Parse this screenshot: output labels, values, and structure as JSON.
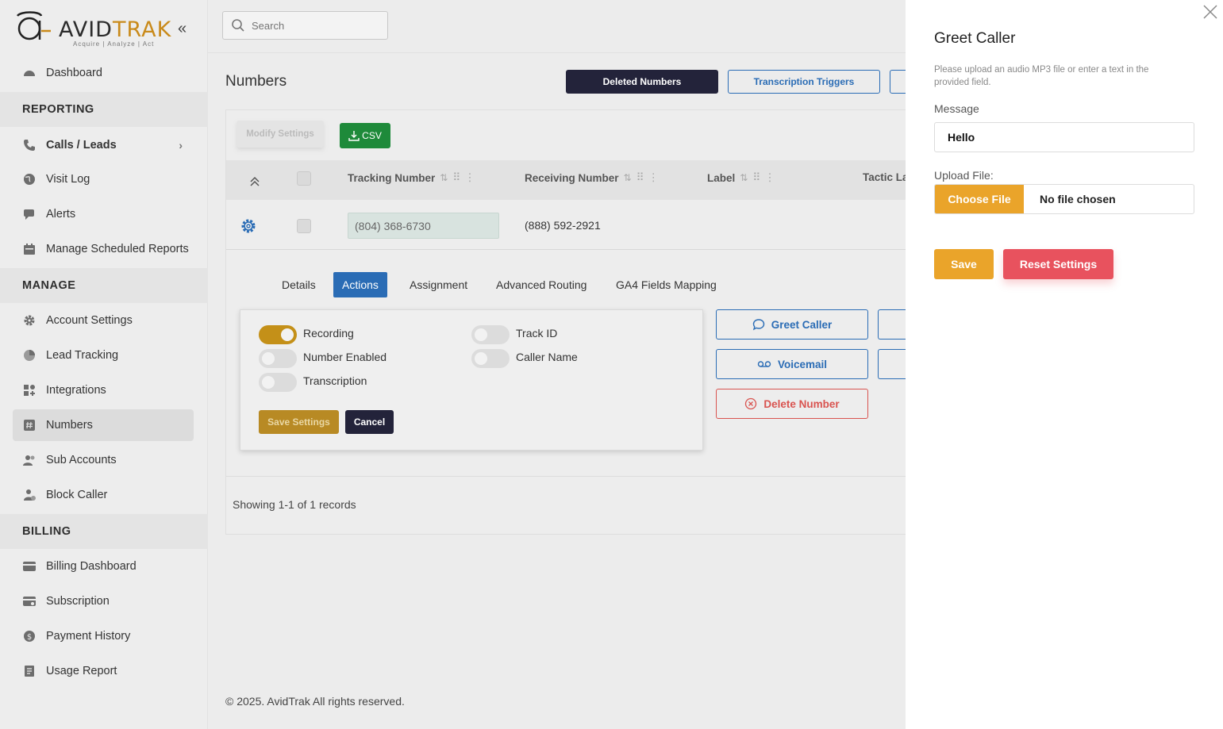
{
  "brand": {
    "name_prefix": "AVID",
    "name_suffix": "TRAK",
    "tagline": "Acquire  |  Analyze  |  Act"
  },
  "sidebar": {
    "dashboard": "Dashboard",
    "reporting_section": "REPORTING",
    "reporting_items": [
      {
        "label": "Calls / Leads",
        "icon": "phone-icon"
      },
      {
        "label": "Visit Log",
        "icon": "globe-icon"
      },
      {
        "label": "Alerts",
        "icon": "chat-icon"
      },
      {
        "label": "Manage Scheduled Reports",
        "icon": "calendar-icon"
      }
    ],
    "manage_section": "MANAGE",
    "manage_items": [
      {
        "label": "Account Settings",
        "icon": "gear-icon"
      },
      {
        "label": "Lead Tracking",
        "icon": "pie-chart-icon"
      },
      {
        "label": "Integrations",
        "icon": "grid-icon"
      },
      {
        "label": "Numbers",
        "icon": "hash-icon"
      },
      {
        "label": "Sub Accounts",
        "icon": "users-icon"
      },
      {
        "label": "Block Caller",
        "icon": "user-block-icon"
      }
    ],
    "billing_section": "BILLING",
    "billing_items": [
      {
        "label": "Billing Dashboard",
        "icon": "card-icon"
      },
      {
        "label": "Subscription",
        "icon": "subscription-icon"
      },
      {
        "label": "Payment History",
        "icon": "dollar-icon"
      },
      {
        "label": "Usage Report",
        "icon": "report-icon"
      }
    ]
  },
  "search": {
    "placeholder": "Search"
  },
  "page": {
    "title": "Numbers",
    "deleted_numbers": "Deleted Numbers",
    "transcription_triggers": "Transcription Triggers",
    "modify_settings": "Modify Settings",
    "csv": "CSV"
  },
  "table": {
    "columns": [
      "Tracking Number",
      "Receiving Number",
      "Label",
      "Tactic La"
    ],
    "row": {
      "tracking": "(804) 368-6730",
      "receiving": "(888) 592-2921"
    }
  },
  "tabs": [
    "Details",
    "Actions",
    "Assignment",
    "Advanced Routing",
    "GA4 Fields Mapping"
  ],
  "toggles": {
    "recording": "Recording",
    "number_enabled": "Number Enabled",
    "transcription": "Transcription",
    "track_id": "Track ID",
    "caller_name": "Caller Name"
  },
  "panel": {
    "save_settings": "Save Settings",
    "cancel": "Cancel"
  },
  "actions": {
    "greet_caller": "Greet Caller",
    "voicemail": "Voicemail",
    "delete_number": "Delete Number"
  },
  "records": "Showing 1-1 of 1 records",
  "footer": "© 2025. AvidTrak All rights reserved.",
  "drawer": {
    "title": "Greet Caller",
    "help": "Please upload an audio MP3 file or enter a text in the provided field.",
    "message_label": "Message",
    "message_value": "Hello",
    "upload_label": "Upload File:",
    "choose_file": "Choose File",
    "no_file": "No file chosen",
    "save": "Save",
    "reset": "Reset Settings"
  },
  "colors": {
    "primary": "#2a6cb5",
    "dark": "#23233a",
    "accent": "#eaa42a",
    "danger": "#e8525e",
    "success": "#1e8a3a"
  }
}
